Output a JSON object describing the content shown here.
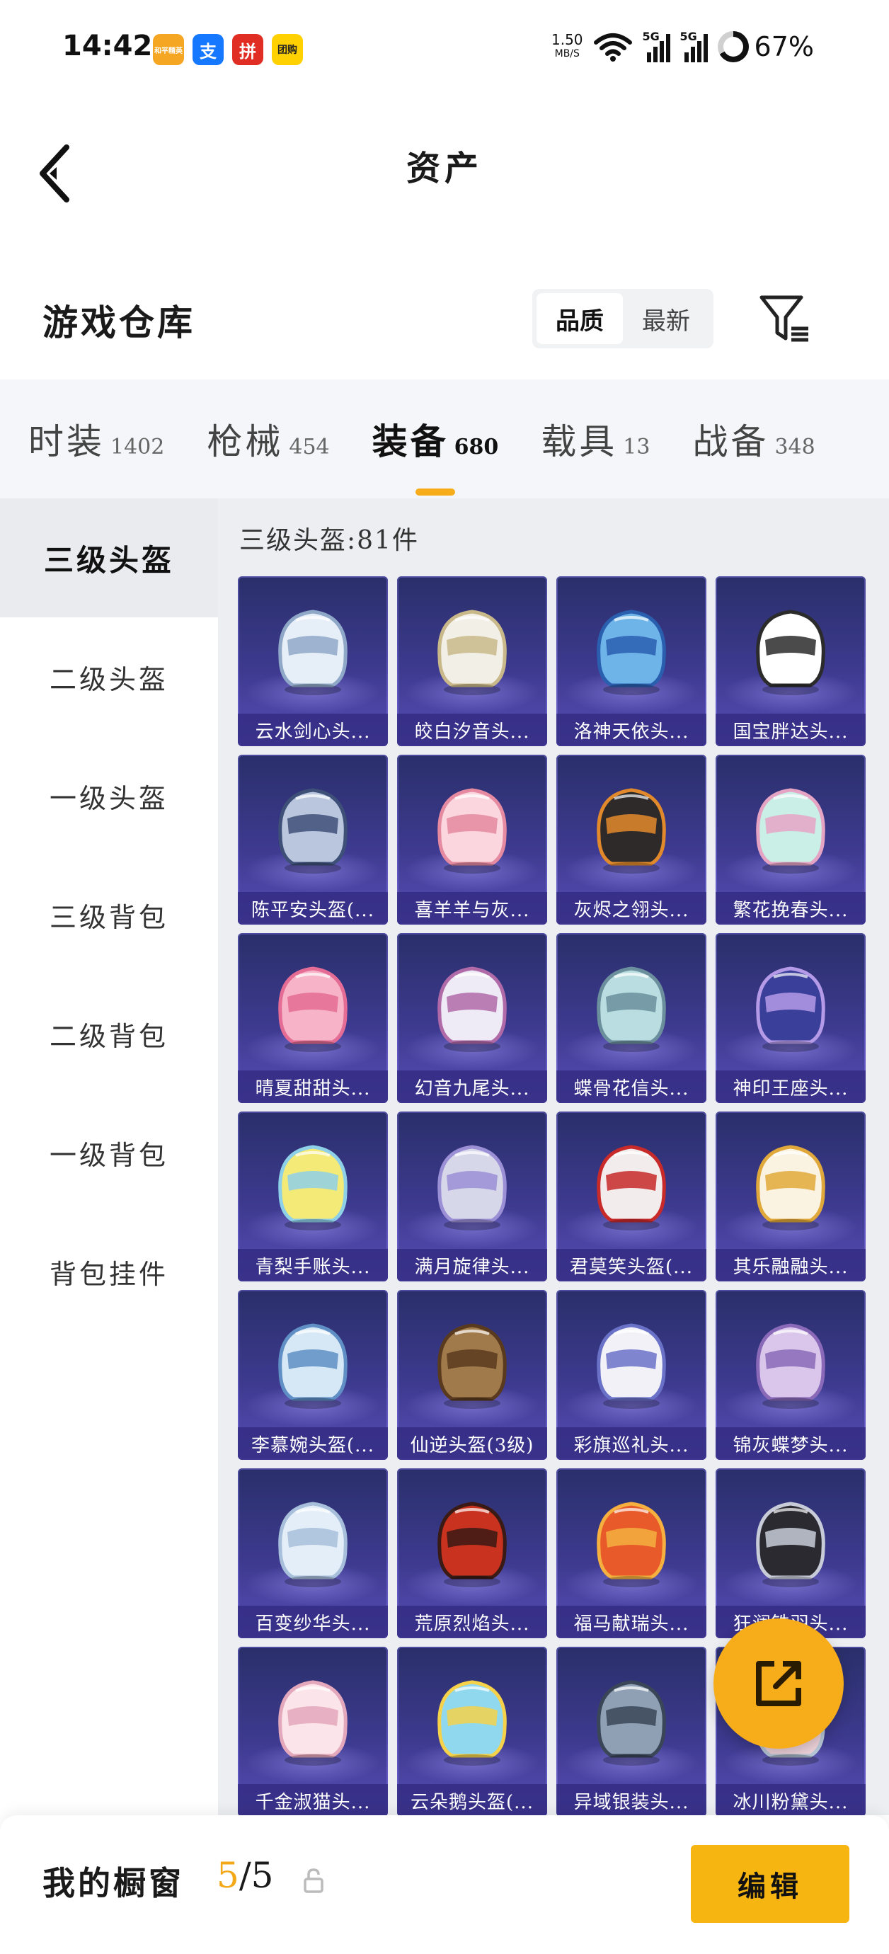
{
  "status_bar": {
    "time": "14:42",
    "apps": [
      {
        "name": "peace-elite-app-icon",
        "label": "和平精英",
        "color": "#f5a623"
      },
      {
        "name": "alipay-app-icon",
        "label": "支",
        "color": "#1677ff"
      },
      {
        "name": "pinduoduo-app-icon",
        "label": "拼",
        "color": "#e02e24"
      },
      {
        "name": "meituan-app-icon",
        "label": "团购",
        "color": "#ffd100"
      }
    ],
    "net_speed_value": "1.50",
    "net_speed_unit": "MB/S",
    "signal_tag_1": "5G",
    "signal_tag_2": "5G",
    "battery": "67%",
    "battery_level": 0.67
  },
  "header": {
    "title": "资产"
  },
  "warehouse": {
    "title": "游戏仓库",
    "sort_options": [
      "品质",
      "最新"
    ],
    "sort_selected": "品质"
  },
  "categories": [
    {
      "name": "时装",
      "count": "1402"
    },
    {
      "name": "枪械",
      "count": "454"
    },
    {
      "name": "装备",
      "count": "680",
      "active": true
    },
    {
      "name": "载具",
      "count": "13"
    },
    {
      "name": "战备",
      "count": "348"
    }
  ],
  "sidebar": [
    {
      "label": "三级头盔",
      "active": true
    },
    {
      "label": "二级头盔"
    },
    {
      "label": "一级头盔"
    },
    {
      "label": "三级背包"
    },
    {
      "label": "二级背包"
    },
    {
      "label": "一级背包"
    },
    {
      "label": "背包挂件"
    }
  ],
  "section": {
    "title": "三级头盔:81件"
  },
  "items": [
    {
      "label": "云水剑心头...",
      "colors": [
        "#e6eef8",
        "#8fa8c8"
      ]
    },
    {
      "label": "皎白汐音头...",
      "colors": [
        "#f2efe6",
        "#c9b98a"
      ]
    },
    {
      "label": "洛神天依头...",
      "colors": [
        "#6fb4e8",
        "#2a5fb0"
      ]
    },
    {
      "label": "国宝胖达头...",
      "colors": [
        "#ffffff",
        "#2b2b2b"
      ]
    },
    {
      "label": "陈平安头盔(...",
      "colors": [
        "#b9c6de",
        "#3e4f78"
      ]
    },
    {
      "label": "喜羊羊与灰...",
      "colors": [
        "#fbd6de",
        "#e58aa0"
      ]
    },
    {
      "label": "灰烬之翎头...",
      "colors": [
        "#2e2a2a",
        "#e28a2b"
      ]
    },
    {
      "label": "繁花挽春头...",
      "colors": [
        "#c9efe6",
        "#e6a4c4"
      ]
    },
    {
      "label": "晴夏甜甜头...",
      "colors": [
        "#f7b3c8",
        "#e56c94"
      ]
    },
    {
      "label": "幻音九尾头...",
      "colors": [
        "#eeeaf6",
        "#b06aa8"
      ]
    },
    {
      "label": "蝶骨花信头...",
      "colors": [
        "#b9dde0",
        "#6b8f9c"
      ]
    },
    {
      "label": "神印王座头...",
      "colors": [
        "#3a3f9a",
        "#b59ae8"
      ]
    },
    {
      "label": "青梨手账头...",
      "colors": [
        "#f4ea78",
        "#8ed0e8"
      ]
    },
    {
      "label": "满月旋律头...",
      "colors": [
        "#d6d8ea",
        "#9b8fd6"
      ]
    },
    {
      "label": "君莫笑头盔(...",
      "colors": [
        "#f2ecec",
        "#c82a2a"
      ]
    },
    {
      "label": "其乐融融头...",
      "colors": [
        "#fbf3e2",
        "#e0a83a"
      ]
    },
    {
      "label": "李慕婉头盔(...",
      "colors": [
        "#d6e8f6",
        "#5f8fc4"
      ]
    },
    {
      "label": "仙逆头盔(3级)",
      "colors": [
        "#a07a4a",
        "#5a3a1e"
      ]
    },
    {
      "label": "彩旗巡礼头...",
      "colors": [
        "#f3f1f8",
        "#6a72c8"
      ]
    },
    {
      "label": "锦灰蝶梦头...",
      "colors": [
        "#d9c6ea",
        "#8a6ab8"
      ]
    },
    {
      "label": "百变纱华头...",
      "colors": [
        "#e4eef8",
        "#a8bfdc"
      ]
    },
    {
      "label": "荒原烈焰头...",
      "colors": [
        "#c8321e",
        "#3a1a14"
      ]
    },
    {
      "label": "福马献瑞头...",
      "colors": [
        "#e85a2a",
        "#f5b040"
      ]
    },
    {
      "label": "狂澜铁羽头...",
      "colors": [
        "#2a2a30",
        "#c8ccd8"
      ]
    },
    {
      "label": "千金淑猫头...",
      "colors": [
        "#fbe4ea",
        "#e4a8bc"
      ]
    },
    {
      "label": "云朵鹅头盔(...",
      "colors": [
        "#8fd8ee",
        "#f5d24a"
      ]
    },
    {
      "label": "异域银装头...",
      "colors": [
        "#8fa0b4",
        "#3a4658"
      ]
    },
    {
      "label": "冰川粉黛头...",
      "colors": [
        "#f0d4dc",
        "#b8c8d8"
      ]
    }
  ],
  "showcase": {
    "label": "我的橱窗",
    "current": "5",
    "total": "/5"
  },
  "edit_button": "编辑"
}
